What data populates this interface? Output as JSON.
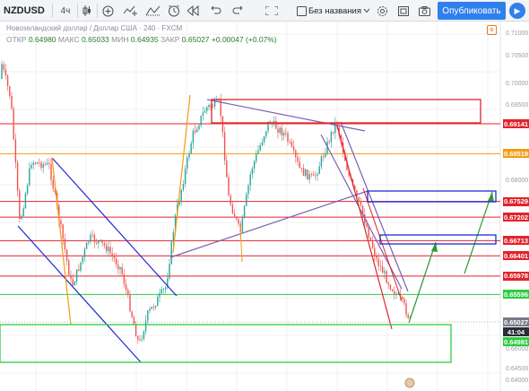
{
  "toolbar": {
    "symbol": "NZDUSD",
    "interval": "4ч",
    "layout_name": "Без названия",
    "publish_label": "Опубликовать"
  },
  "legend": {
    "title": "Новозеландский доллар / Доллар США · 240 · FXCM",
    "open_label": "ОТКР",
    "open": "0.64980",
    "high_label": "МАКС",
    "high": "0.65033",
    "low_label": "МИН",
    "low": "0.64935",
    "close_label": "ЗАКР",
    "close": "0.65027",
    "change": "+0.00047 (+0.07%)"
  },
  "price_axis": {
    "ticks": [
      "0.71000",
      "0.70500",
      "0.70000",
      "0.69500",
      "0.68000",
      "0.66000",
      "0.64500",
      "0.64000"
    ]
  },
  "chart_data": {
    "type": "candlestick",
    "symbol": "NZDUSD",
    "timeframe": "240",
    "price_range": [
      0.6375,
      0.7125
    ],
    "last_price": 0.65027,
    "countdown": "41:04",
    "bid_label": 0.64981,
    "horizontal_levels": [
      {
        "price": 0.69141,
        "color": "#e0242a",
        "label": "0.69141"
      },
      {
        "price": 0.68519,
        "color": "#f39c12",
        "label": "0.68519"
      },
      {
        "price": 0.67529,
        "color": "#e0242a",
        "label": "0.67529"
      },
      {
        "price": 0.67202,
        "color": "#e0242a",
        "label": "0.67202"
      },
      {
        "price": 0.66713,
        "color": "#e0242a",
        "label": "0.66713"
      },
      {
        "price": 0.66401,
        "color": "#e0242a",
        "label": "0.66401"
      },
      {
        "price": 0.65978,
        "color": "#e0242a",
        "label": "0.65978"
      },
      {
        "price": 0.65596,
        "color": "#2ecc40",
        "label": "0.65596"
      }
    ]
  },
  "colors": {
    "up": "#26a69a",
    "down": "#ef5350",
    "red_level": "#e0242a",
    "orange": "#f39c12",
    "green": "#2ecc40",
    "blue_channel": "#1f2bd6",
    "purple_channel": "#7a5fb5",
    "last_price_bg": "#787b86",
    "countdown_bg": "#2a2e39",
    "bid_bg": "#2ecc40"
  }
}
